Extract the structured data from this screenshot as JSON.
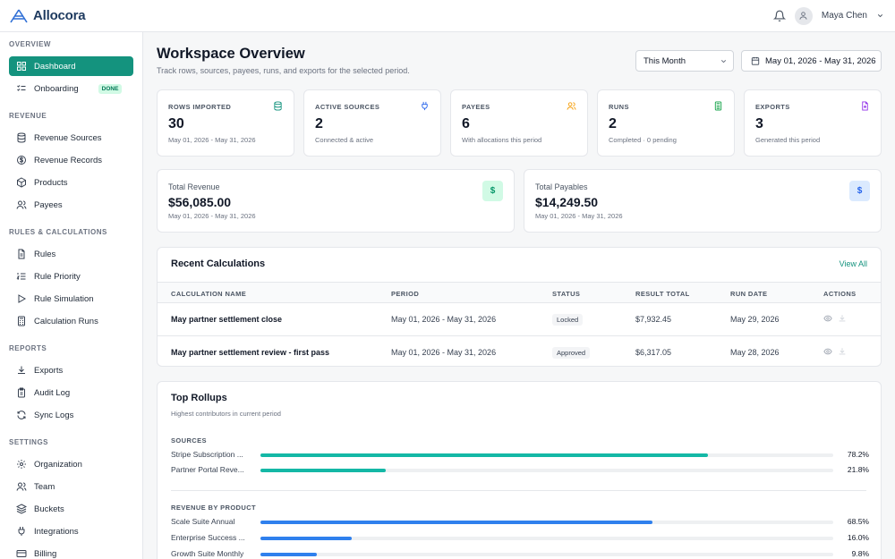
{
  "app": {
    "name": "Allocora"
  },
  "user": {
    "name": "Maya Chen"
  },
  "sidebar": {
    "sections": [
      {
        "label": "OVERVIEW",
        "items": [
          {
            "label": "Dashboard",
            "icon": "grid-icon",
            "active": true
          },
          {
            "label": "Onboarding",
            "icon": "checklist-icon",
            "badge": "DONE"
          }
        ]
      },
      {
        "label": "REVENUE",
        "items": [
          {
            "label": "Revenue Sources",
            "icon": "database-icon"
          },
          {
            "label": "Revenue Records",
            "icon": "dollar-circle-icon"
          },
          {
            "label": "Products",
            "icon": "box-icon"
          },
          {
            "label": "Payees",
            "icon": "users-icon"
          }
        ]
      },
      {
        "label": "RULES & CALCULATIONS",
        "items": [
          {
            "label": "Rules",
            "icon": "document-icon"
          },
          {
            "label": "Rule Priority",
            "icon": "ordered-list-icon"
          },
          {
            "label": "Rule Simulation",
            "icon": "play-icon"
          },
          {
            "label": "Calculation Runs",
            "icon": "calculator-icon"
          }
        ]
      },
      {
        "label": "REPORTS",
        "items": [
          {
            "label": "Exports",
            "icon": "download-icon"
          },
          {
            "label": "Audit Log",
            "icon": "clipboard-icon"
          },
          {
            "label": "Sync Logs",
            "icon": "refresh-icon"
          }
        ]
      },
      {
        "label": "SETTINGS",
        "items": [
          {
            "label": "Organization",
            "icon": "gear-icon"
          },
          {
            "label": "Team",
            "icon": "users-icon"
          },
          {
            "label": "Buckets",
            "icon": "layers-icon"
          },
          {
            "label": "Integrations",
            "icon": "plug-icon"
          },
          {
            "label": "Billing",
            "icon": "credit-card-icon"
          }
        ]
      }
    ]
  },
  "header": {
    "title": "Workspace Overview",
    "subtitle": "Track rows, sources, payees, runs, and exports for the selected period.",
    "period_select": "This Month",
    "date_range": "May 01, 2026 - May 31, 2026"
  },
  "stats": [
    {
      "label": "ROWS IMPORTED",
      "value": "30",
      "sub": "May 01, 2026 - May 31, 2026",
      "icon": "database-icon",
      "color": "#14937e"
    },
    {
      "label": "ACTIVE SOURCES",
      "value": "2",
      "sub": "Connected & active",
      "icon": "plug-icon",
      "color": "#2563eb"
    },
    {
      "label": "PAYEES",
      "value": "6",
      "sub": "With allocations this period",
      "icon": "users-icon",
      "color": "#f59e0b"
    },
    {
      "label": "RUNS",
      "value": "2",
      "sub": "Completed · 0 pending",
      "icon": "calculator-icon",
      "color": "#16a34a"
    },
    {
      "label": "EXPORTS",
      "value": "3",
      "sub": "Generated this period",
      "icon": "file-icon",
      "color": "#9333ea"
    }
  ],
  "totals": [
    {
      "label": "Total Revenue",
      "value": "$56,085.00",
      "sub": "May 01, 2026 - May 31, 2026",
      "icon": "$",
      "bg": "#d1fae5",
      "fg": "#059669"
    },
    {
      "label": "Total Payables",
      "value": "$14,249.50",
      "sub": "May 01, 2026 - May 31, 2026",
      "icon": "$",
      "bg": "#dbeafe",
      "fg": "#2563eb"
    }
  ],
  "recent": {
    "title": "Recent Calculations",
    "view_all": "View All",
    "columns": [
      "CALCULATION NAME",
      "PERIOD",
      "STATUS",
      "RESULT TOTAL",
      "RUN DATE",
      "ACTIONS"
    ],
    "rows": [
      {
        "name": "May partner settlement close",
        "period": "May 01, 2026 - May 31, 2026",
        "status": "Locked",
        "total": "$7,932.45",
        "run_date": "May 29, 2026"
      },
      {
        "name": "May partner settlement review - first pass",
        "period": "May 01, 2026 - May 31, 2026",
        "status": "Approved",
        "total": "$6,317.05",
        "run_date": "May 28, 2026"
      }
    ]
  },
  "rollups": {
    "title": "Top Rollups",
    "subtitle": "Highest contributors in current period",
    "groups": [
      {
        "label": "SOURCES",
        "color": "#14b8a6",
        "items": [
          {
            "name": "Stripe Subscription ...",
            "pct_label": "78.2%",
            "pct": 78.2
          },
          {
            "name": "Partner Portal Reve...",
            "pct_label": "21.8%",
            "pct": 21.8
          }
        ]
      },
      {
        "label": "REVENUE BY PRODUCT",
        "color": "#2f80ed",
        "items": [
          {
            "name": "Scale Suite Annual",
            "pct_label": "68.5%",
            "pct": 68.5
          },
          {
            "name": "Enterprise Success ...",
            "pct_label": "16.0%",
            "pct": 16.0
          },
          {
            "name": "Growth Suite Monthly",
            "pct_label": "9.8%",
            "pct": 9.8
          }
        ]
      }
    ]
  }
}
